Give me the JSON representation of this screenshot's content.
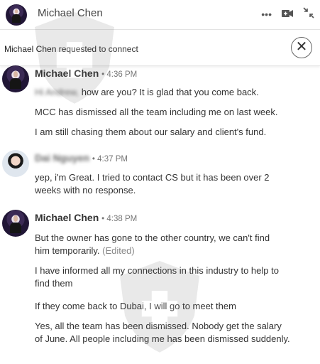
{
  "header": {
    "name": "Michael Chen",
    "more_icon": "more-horizontal-icon",
    "video_icon": "video-call-icon",
    "collapse_icon": "minimize-icon"
  },
  "banner": {
    "requester": "Michael Chen",
    "text": "requested to connect",
    "close_label": "✕"
  },
  "messages": [
    {
      "sender": "Michael Chen",
      "time": "• 4:36 PM",
      "lines": [
        {
          "blur_prefix": "Hi Andrew,",
          "text": " how are you? It is glad that you come back."
        },
        {
          "text": "MCC has dismissed all the team including me on last week."
        },
        {
          "text": "I am still chasing them about our salary and client's fund."
        }
      ]
    },
    {
      "sender": "Dai Nguyen",
      "time": "• 4:37 PM",
      "lines": [
        {
          "text": "yep, i'm Great. I tried to contact CS but it has been over 2 weeks with no response."
        }
      ]
    },
    {
      "sender": "Michael Chen",
      "time": "• 4:38 PM",
      "lines": [
        {
          "text": "But the owner has gone to the other country, we can't find him temporarily.",
          "edited": "(Edited)"
        },
        {
          "text": "I have informed all my connections in this industry to help to find them"
        },
        {
          "text": "If they come back to Dubai, I will go to meet them"
        },
        {
          "text": "Yes, all the team has been dismissed. Nobody get the salary of June. All people including me has been dismissed suddenly."
        }
      ]
    }
  ],
  "colors": {
    "accent": "#444444",
    "muted": "#777777"
  }
}
